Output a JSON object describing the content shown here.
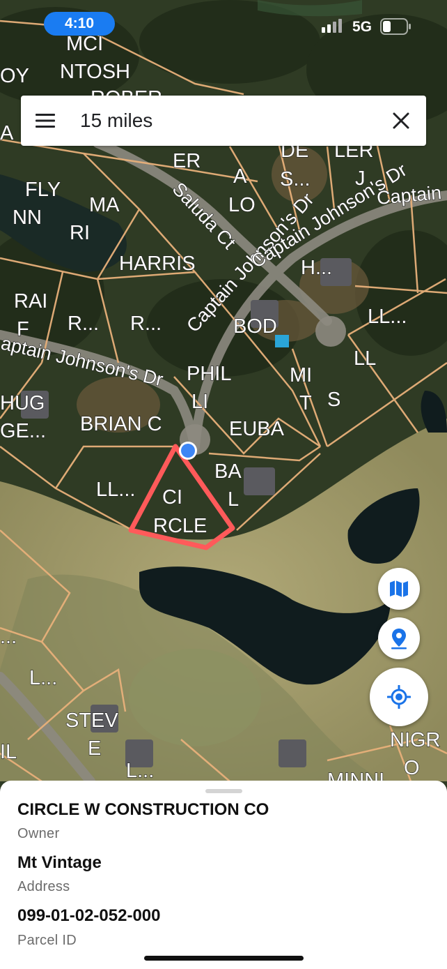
{
  "status": {
    "time": "4:10",
    "network": "5G"
  },
  "search": {
    "query": "15 miles"
  },
  "map": {
    "parcel_labels": [
      "MCI",
      "NTOSH",
      "ROBER",
      "OY",
      "A",
      "ER",
      "DE",
      "S...",
      "LER",
      "J",
      "FLY",
      "NN",
      "MA",
      "RI",
      "A",
      "LO",
      "HARRIS",
      "H...",
      "RAI",
      "F",
      "R...",
      "R...",
      "BOD",
      "LL...",
      "LL",
      "PHIL",
      "LI",
      "MI",
      "T",
      "S",
      "HUG",
      "GE...",
      "BRIAN C",
      "EUBA",
      "BA",
      "L",
      "LL...",
      "CI",
      "RCLE",
      "...",
      "L...",
      "STEV",
      "E",
      "L...",
      "IL",
      "NIGR",
      "O",
      "MINNI"
    ],
    "road_labels": [
      "Saluda Ct",
      "Captain Johnson's Dr",
      "Captain Johnson's Dr",
      "Captain"
    ],
    "colors": {
      "parcel_line": "#e8b07a",
      "highlight": "#ff5a5a",
      "location_dot": "#3d86f5"
    }
  },
  "controls": {
    "layers_icon": "map-layers-icon",
    "pin_icon": "location-pin-icon",
    "locate_icon": "my-location-icon",
    "accent": "#1a73e8"
  },
  "details": {
    "owner_value": "CIRCLE W CONSTRUCTION CO",
    "owner_label": "Owner",
    "address_value": "Mt Vintage",
    "address_label": "Address",
    "parcel_value": "099-01-02-052-000",
    "parcel_label": "Parcel ID"
  }
}
